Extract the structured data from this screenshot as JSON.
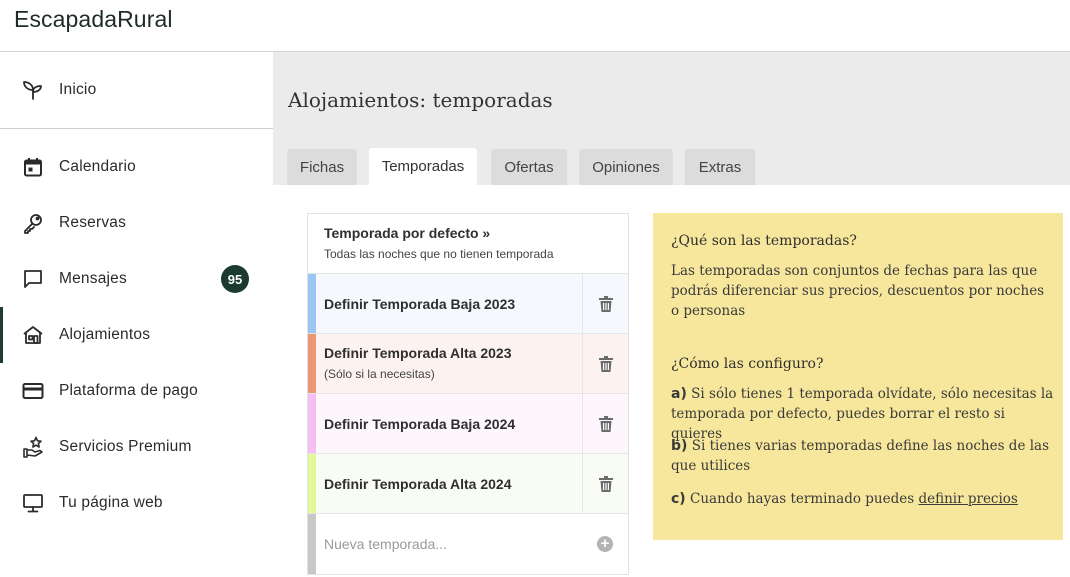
{
  "brand": "EscapadaRural",
  "sidebar": {
    "items": [
      {
        "label": "Inicio",
        "icon": "sprout-icon"
      },
      {
        "label": "Calendario",
        "icon": "calendar-icon"
      },
      {
        "label": "Reservas",
        "icon": "key-icon"
      },
      {
        "label": "Mensajes",
        "icon": "chat-icon",
        "badge": "95"
      },
      {
        "label": "Alojamientos",
        "icon": "house-icon",
        "active": true
      },
      {
        "label": "Plataforma de pago",
        "icon": "credit-card-icon"
      },
      {
        "label": "Servicios Premium",
        "icon": "premium-star-icon"
      },
      {
        "label": "Tu página web",
        "icon": "monitor-icon"
      }
    ]
  },
  "main": {
    "title": "Alojamientos: temporadas",
    "tabs": [
      {
        "label": "Fichas"
      },
      {
        "label": "Temporadas",
        "active": true
      },
      {
        "label": "Ofertas"
      },
      {
        "label": "Opiniones"
      },
      {
        "label": "Extras"
      }
    ]
  },
  "seasons": {
    "default": {
      "name": "Temporada por defecto »",
      "sub": "Todas las noches que no tienen temporada"
    },
    "items": [
      {
        "name": "Definir Temporada Baja 2023",
        "sub": "",
        "color": "#9cc6f2",
        "bg": "#f5f8fc"
      },
      {
        "name": "Definir Temporada Alta 2023",
        "sub": "(Sólo si la necesitas)",
        "color": "#eb9677",
        "bg": "#fcf3f1"
      },
      {
        "name": "Definir Temporada Baja 2024",
        "sub": "",
        "color": "#f6bff2",
        "bg": "#fdf6fd"
      },
      {
        "name": "Definir Temporada Alta 2024",
        "sub": "",
        "color": "#e4f79b",
        "bg": "#f9fcf4"
      }
    ],
    "new_placeholder": "Nueva temporada...",
    "new_stripe_color": "#c8c8c8"
  },
  "info": {
    "q1": "¿Qué son las temporadas?",
    "a1": "Las temporadas son conjuntos de fechas para las que podrás diferenciar sus precios, descuentos por noches o personas",
    "q2": "¿Cómo las configuro?",
    "a_prefix": "a)",
    "a_text": "Si sólo tienes 1 temporada olvídate, sólo necesitas la temporada por defecto, puedes borrar el resto si quieres",
    "b_prefix": "b)",
    "b_text": "Si tienes varias temporadas define las noches de las que utilices",
    "c_prefix": "c)",
    "c_text": "Cuando hayas terminado puedes",
    "c_link": "definir precios"
  },
  "colors": {
    "accent": "#1d3a32",
    "info_bg": "#f7e79c",
    "main_bg": "#ebebeb"
  }
}
